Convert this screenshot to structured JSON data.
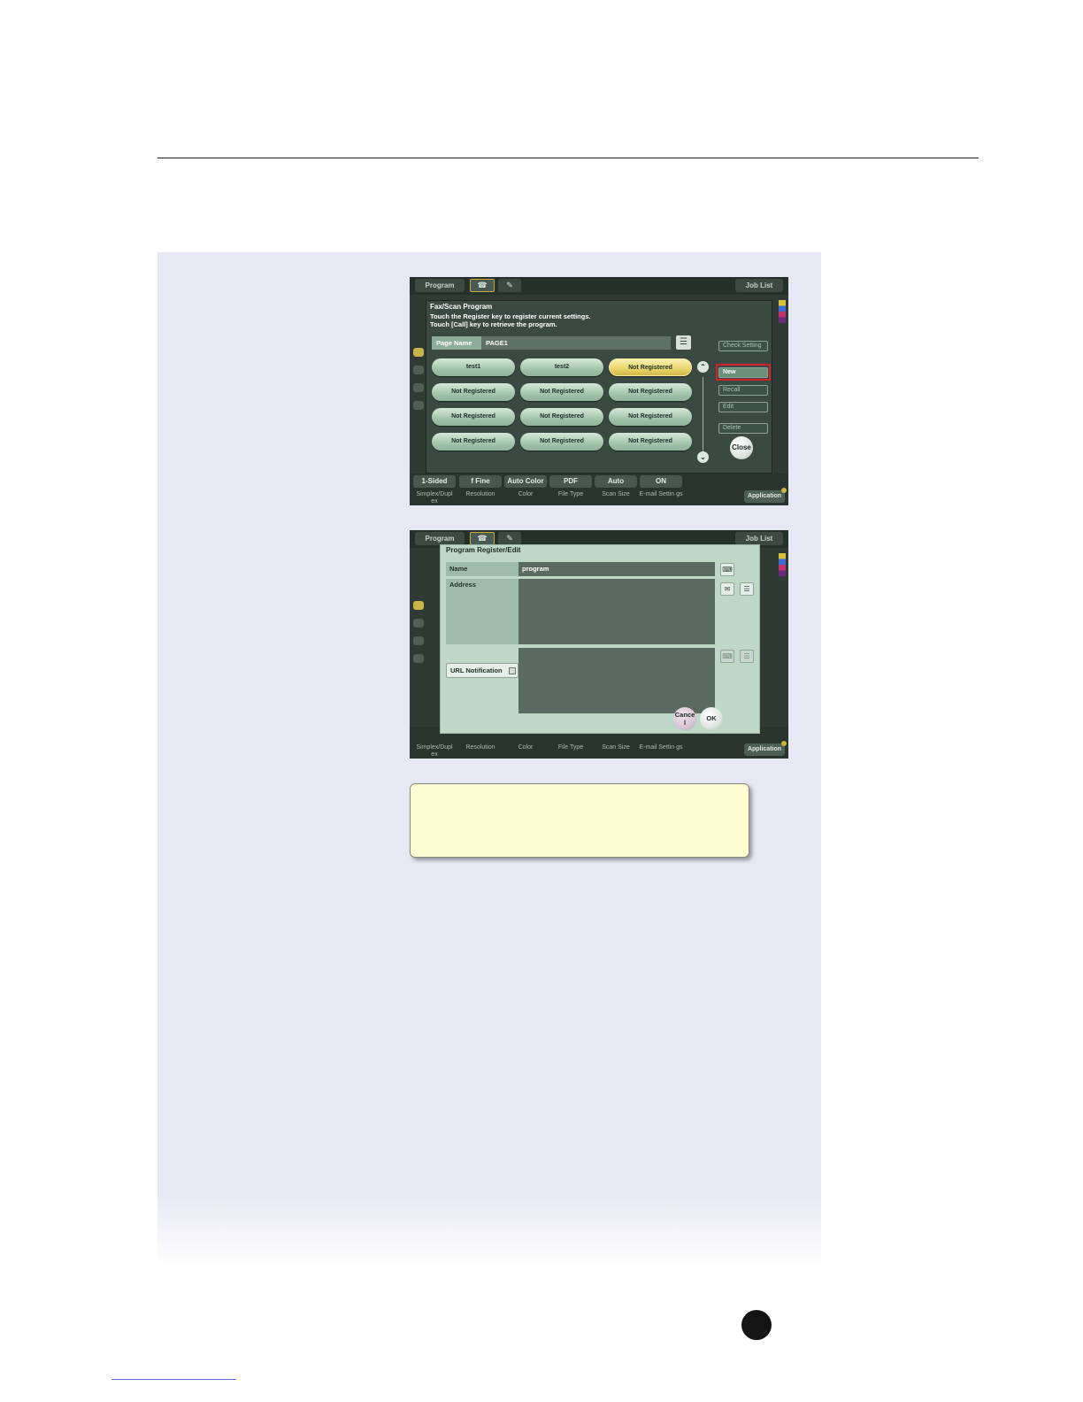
{
  "screen1": {
    "topbar": {
      "program": "Program",
      "joblist": "Job List"
    },
    "title": "Fax/Scan Program",
    "instruction_line1": "Touch the Register key to register current settings.",
    "instruction_line2": "Touch [Call] key to retrieve the program.",
    "page_name_label": "Page Name",
    "page_name_value": "PAGE1",
    "programs": [
      "test1",
      "test2",
      "Not Registered",
      "Not Registered",
      "Not Registered",
      "Not Registered",
      "Not Registered",
      "Not Registered",
      "Not Registered",
      "Not Registered",
      "Not Registered",
      "Not Registered"
    ],
    "side": {
      "check_setting": "Check Setting",
      "new": "New",
      "recall": "Recall",
      "edit": "Edit",
      "delete": "Delete"
    },
    "close": "Close",
    "bottom_buttons": [
      "1-Sided",
      "f Fine",
      "Auto Color",
      "PDF",
      "Auto",
      "ON"
    ],
    "bottom_labels": [
      "Simplex/Dupl ex",
      "Resolution",
      "Color",
      "File Type",
      "Scan Size",
      "E-mail Settin gs"
    ],
    "application": "Application"
  },
  "screen2": {
    "topbar": {
      "program": "Program",
      "joblist": "Job List"
    },
    "title": "Program Register/Edit",
    "name_label": "Name",
    "name_value": "program",
    "address_label": "Address",
    "url_label": "URL Notification",
    "cancel": "Cance l",
    "ok": "OK",
    "bottom_labels": [
      "Simplex/Dupl ex",
      "Resolution",
      "Color",
      "File Type",
      "Scan Size",
      "E-mail Settin gs"
    ],
    "application": "Application"
  },
  "colors": {
    "highlight": "#d3212c",
    "selected": "#e9d56a",
    "note_bg": "#fefdd4"
  }
}
